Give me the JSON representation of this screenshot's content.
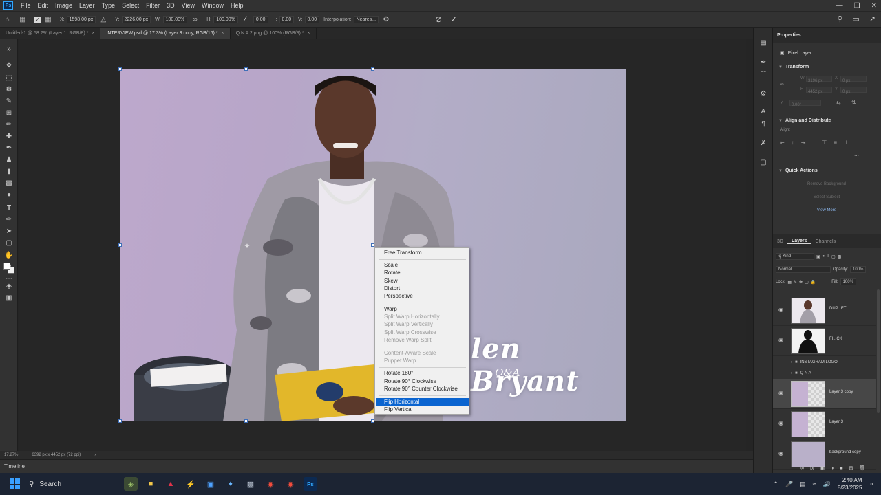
{
  "menubar": {
    "logo": "Ps",
    "items": [
      "File",
      "Edit",
      "Image",
      "Layer",
      "Type",
      "Select",
      "Filter",
      "3D",
      "View",
      "Window",
      "Help"
    ]
  },
  "options": {
    "x_label": "X:",
    "x_value": "1598.00 px",
    "y_label": "Y:",
    "y_value": "2226.00 px",
    "w_label": "W:",
    "w_value": "100.00%",
    "h_label": "H:",
    "h_value": "100.00%",
    "angle_value": "0.00",
    "hskew_label": "H:",
    "hskew_value": "0.00",
    "vskew_label": "V:",
    "vskew_value": "0.00",
    "interp_label": "Interpolation:",
    "interp_value": "Neares..."
  },
  "tabs": [
    {
      "label": "Untitled-1 @ 58.2% (Layer 1, RGB/8) *"
    },
    {
      "label": "INTERVIEW.psd @ 17.3% (Layer 3 copy, RGB/16) *"
    },
    {
      "label": "Q N A 2.png @ 100% (RGB/8) *"
    }
  ],
  "canvas": {
    "brand_text": "len Bryant",
    "brand_sub": "Q&A"
  },
  "context_menu": {
    "items": [
      {
        "label": "Free Transform",
        "disabled": false
      },
      {
        "label": "Scale",
        "disabled": false
      },
      {
        "label": "Rotate",
        "disabled": false
      },
      {
        "label": "Skew",
        "disabled": false
      },
      {
        "label": "Distort",
        "disabled": false
      },
      {
        "label": "Perspective",
        "disabled": false
      },
      {
        "label": "Warp",
        "disabled": false
      },
      {
        "label": "Split Warp Horizontally",
        "disabled": true
      },
      {
        "label": "Split Warp Vertically",
        "disabled": true
      },
      {
        "label": "Split Warp Crosswise",
        "disabled": true
      },
      {
        "label": "Remove Warp Split",
        "disabled": true
      },
      {
        "label": "Content-Aware Scale",
        "disabled": true
      },
      {
        "label": "Puppet Warp",
        "disabled": true
      },
      {
        "label": "Rotate 180°",
        "disabled": false
      },
      {
        "label": "Rotate 90° Clockwise",
        "disabled": false
      },
      {
        "label": "Rotate 90° Counter Clockwise",
        "disabled": false
      },
      {
        "label": "Flip Horizontal",
        "disabled": false,
        "selected": true
      },
      {
        "label": "Flip Vertical",
        "disabled": false
      }
    ]
  },
  "status": {
    "zoom": "17.27%",
    "doc_size": "6392 px x 4452 px (72 ppi)"
  },
  "timeline": {
    "label": "Timeline"
  },
  "properties": {
    "title": "Properties",
    "layer_type": "Pixel Layer",
    "transform_head": "Transform",
    "w_label": "W",
    "w_value": "3196 px",
    "x_label": "X",
    "x_value": "0 px",
    "h_label": "H",
    "h_value": "4452 px",
    "y_label": "Y",
    "y_value": "0 px",
    "angle_value": "0.00°",
    "align_head": "Align and Distribute",
    "align_label": "Align:",
    "quick_head": "Quick Actions",
    "remove_bg": "Remove Background",
    "select_subject": "Select Subject",
    "view_more": "View More"
  },
  "layers_panel": {
    "tabs": [
      "3D",
      "Layers",
      "Channels"
    ],
    "kind": "Kind",
    "blend_mode": "Normal",
    "opacity_label": "Opacity:",
    "opacity_value": "100%",
    "lock_label": "Lock:",
    "fill_label": "Fill:",
    "fill_value": "100%",
    "layers": [
      {
        "name": "DUP...ET",
        "type": "photo"
      },
      {
        "name": "FI...CK",
        "type": "silhouette"
      },
      {
        "name": "INSTAGRAM LOGO",
        "type": "group"
      },
      {
        "name": "Q N A",
        "type": "group"
      },
      {
        "name": "Layer 3 copy",
        "type": "checker",
        "active": true
      },
      {
        "name": "Layer 3",
        "type": "checker"
      },
      {
        "name": "background copy",
        "type": "lavender"
      }
    ]
  },
  "taskbar": {
    "search_label": "Search",
    "time": "2:40 AM",
    "date": "8/23/2025"
  },
  "colors": {
    "accent": "#0a64d0",
    "selection": "#5a84c6"
  }
}
